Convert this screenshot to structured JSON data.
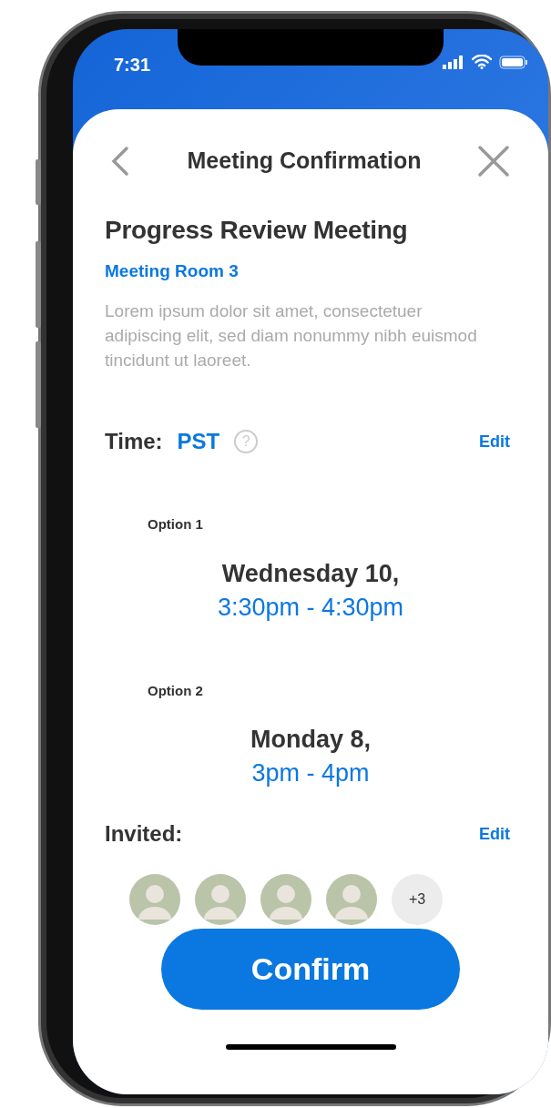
{
  "status_bar": {
    "time": "7:31"
  },
  "header": {
    "title": "Meeting Confirmation"
  },
  "meeting": {
    "title": "Progress Review Meeting",
    "room": "Meeting Room 3",
    "description": "Lorem ipsum dolor sit amet, consectetuer adipiscing elit, sed diam nonummy nibh euismod tincidunt ut laoreet."
  },
  "time": {
    "label": "Time:",
    "zone": "PST",
    "help": "?",
    "edit": "Edit"
  },
  "options": [
    {
      "label": "Option 1",
      "day": "Wednesday 10,",
      "range": "3:30pm - 4:30pm"
    },
    {
      "label": "Option 2",
      "day": "Monday 8,",
      "range": "3pm - 4pm"
    }
  ],
  "invited": {
    "label": "Invited:",
    "edit": "Edit",
    "more": "+3"
  },
  "confirm_button": "Confirm"
}
